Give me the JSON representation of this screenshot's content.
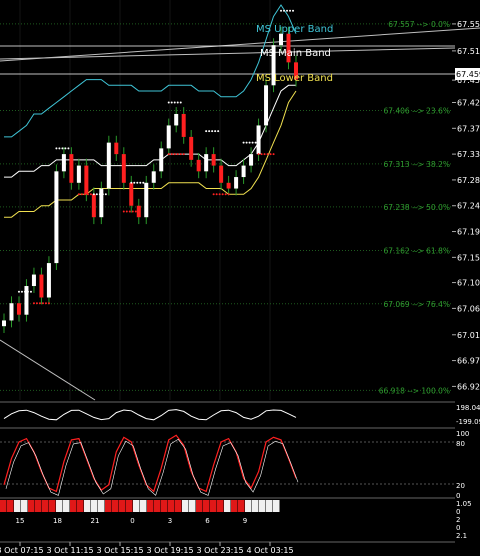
{
  "window": {
    "background": "#000000"
  },
  "price_axis": {
    "ticks": [
      "67.557",
      "67.510",
      "67.459",
      "67.420",
      "67.375",
      "67.330",
      "67.285",
      "67.240",
      "67.195",
      "67.150",
      "67.106",
      "67.061",
      "67.015",
      "66.970",
      "66.925"
    ],
    "current_price": "67.459",
    "ylim": [
      66.91,
      67.59
    ]
  },
  "fib_levels": [
    {
      "label": "67.557 --> 0.0%",
      "price": 67.557
    },
    {
      "label": "67.406 --> 23.6%",
      "price": 67.406
    },
    {
      "label": "67.313 --> 38.2%",
      "price": 67.313
    },
    {
      "label": "67.238 --> 50.0%",
      "price": 67.238
    },
    {
      "label": "67.162 --> 61.8%",
      "price": 67.162
    },
    {
      "label": "67.069 --> 76.4%",
      "price": 67.069
    },
    {
      "label": "66.918 --> 100.0%",
      "price": 66.918
    }
  ],
  "bands": {
    "upper_label": "MS Upper Band",
    "main_label": "MS Main Band",
    "lower_label": "MS Lower Band",
    "upper_color": "#3fc4d6",
    "main_color": "#ffffff",
    "lower_color": "#f0e050"
  },
  "oscillator1": {
    "ticks": [
      "198.04",
      "-199.09"
    ]
  },
  "oscillator2": {
    "ticks": [
      "100",
      "80",
      "20",
      "0"
    ],
    "color": "#ff2020"
  },
  "oscillator3": {
    "ticks": [
      "1.05",
      "0",
      "2",
      "0",
      "2.1"
    ]
  },
  "hour_labels": [
    "15",
    "18",
    "21",
    "0",
    "3",
    "6",
    "9"
  ],
  "time_labels": [
    "3 Oct 07:15",
    "3 Oct 11:15",
    "3 Oct 15:15",
    "3 Oct 19:15",
    "3 Oct 23:15",
    "4 Oct 03:15"
  ],
  "chart_data": {
    "type": "line",
    "close": [
      67.04,
      67.07,
      67.05,
      67.1,
      67.12,
      67.08,
      67.14,
      67.3,
      67.33,
      67.28,
      67.31,
      67.26,
      67.22,
      67.27,
      67.35,
      67.33,
      67.28,
      67.24,
      67.22,
      67.28,
      67.3,
      67.34,
      67.38,
      67.4,
      67.36,
      67.32,
      67.3,
      67.33,
      67.31,
      67.28,
      67.27,
      67.29,
      67.31,
      67.33,
      67.38,
      67.45,
      67.52,
      67.54,
      67.49,
      67.46
    ],
    "upper_band": [
      67.36,
      67.36,
      67.37,
      67.38,
      67.4,
      67.4,
      67.41,
      67.42,
      67.43,
      67.44,
      67.45,
      67.46,
      67.46,
      67.46,
      67.45,
      67.45,
      67.45,
      67.45,
      67.44,
      67.44,
      67.44,
      67.44,
      67.45,
      67.45,
      67.45,
      67.45,
      67.44,
      67.44,
      67.44,
      67.43,
      67.43,
      67.43,
      67.44,
      67.46,
      67.49,
      67.53,
      67.57,
      67.59,
      67.57,
      67.54
    ],
    "main_band": [
      67.29,
      67.29,
      67.3,
      67.3,
      67.3,
      67.31,
      67.31,
      67.32,
      67.32,
      67.32,
      67.32,
      67.32,
      67.32,
      67.31,
      67.31,
      67.31,
      67.31,
      67.31,
      67.31,
      67.31,
      67.32,
      67.32,
      67.33,
      67.33,
      67.33,
      67.33,
      67.33,
      67.32,
      67.32,
      67.32,
      67.31,
      67.31,
      67.32,
      67.33,
      67.35,
      67.38,
      67.41,
      67.44,
      67.45,
      67.45
    ],
    "lower_band": [
      67.22,
      67.22,
      67.23,
      67.23,
      67.23,
      67.24,
      67.24,
      67.25,
      67.25,
      67.25,
      67.26,
      67.26,
      67.27,
      67.27,
      67.27,
      67.27,
      67.27,
      67.27,
      67.27,
      67.27,
      67.27,
      67.27,
      67.28,
      67.28,
      67.28,
      67.28,
      67.28,
      67.27,
      67.27,
      67.27,
      67.26,
      67.26,
      67.26,
      67.27,
      67.29,
      67.32,
      67.35,
      67.38,
      67.42,
      67.44
    ],
    "oscillator2": [
      20,
      60,
      85,
      90,
      70,
      40,
      15,
      10,
      55,
      88,
      90,
      60,
      30,
      12,
      20,
      70,
      92,
      85,
      50,
      20,
      10,
      45,
      88,
      95,
      80,
      40,
      15,
      10,
      50,
      85,
      90,
      70,
      30,
      15,
      40,
      85,
      92,
      88,
      60,
      30
    ],
    "sentiment_bar": [
      "red",
      "red",
      "white",
      "white",
      "red",
      "red",
      "red",
      "red",
      "white",
      "white",
      "red",
      "red",
      "white",
      "white",
      "white",
      "red",
      "red",
      "red",
      "red",
      "white",
      "white",
      "red",
      "red",
      "red",
      "red",
      "red",
      "white",
      "white",
      "red",
      "red",
      "red",
      "red",
      "white",
      "red",
      "red",
      "white",
      "white",
      "white",
      "white",
      "white"
    ]
  }
}
